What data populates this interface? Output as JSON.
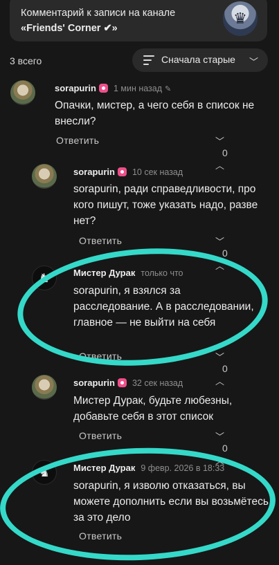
{
  "header": {
    "line1": "Комментарий к записи на канале",
    "line2": "«Friends' Corner ✔»"
  },
  "toolbar": {
    "count": "3 всего",
    "sort_label": "Сначала старые"
  },
  "comments": [
    {
      "author": "sorapurin",
      "time": "1 мин назад",
      "text": "Опачки, мистер, а чего себя в список не внесли?",
      "reply": "Ответить",
      "votes": "0"
    },
    {
      "author": "sorapurin",
      "time": "10 сек назад",
      "text": "sorapurin, ради справедливости, про кого пишут, тоже указать надо, разве нет?",
      "reply": "Ответить",
      "votes": "0"
    },
    {
      "author": "Мистер Дурак",
      "time": "только что",
      "text": "sorapurin, я взялся за расследование. А в расследовании, главное — не выйти на себя",
      "reply": "Ответить",
      "votes": "0"
    },
    {
      "author": "sorapurin",
      "time": "32 сек назад",
      "text": "Мистер Дурак, будьте любезны, добавьте себя в этот список",
      "reply": "Ответить",
      "votes": "0"
    },
    {
      "author": "Мистер Дурак",
      "time": "9 февр. 2026 в 18:33",
      "text": "sorapurin, я изволю отказаться, вы можете дополнить если вы возьмётесь за это дело",
      "reply": "Ответить",
      "votes": ""
    }
  ],
  "colors": {
    "highlight": "#35d9c9",
    "badge": "#f04e8a"
  }
}
